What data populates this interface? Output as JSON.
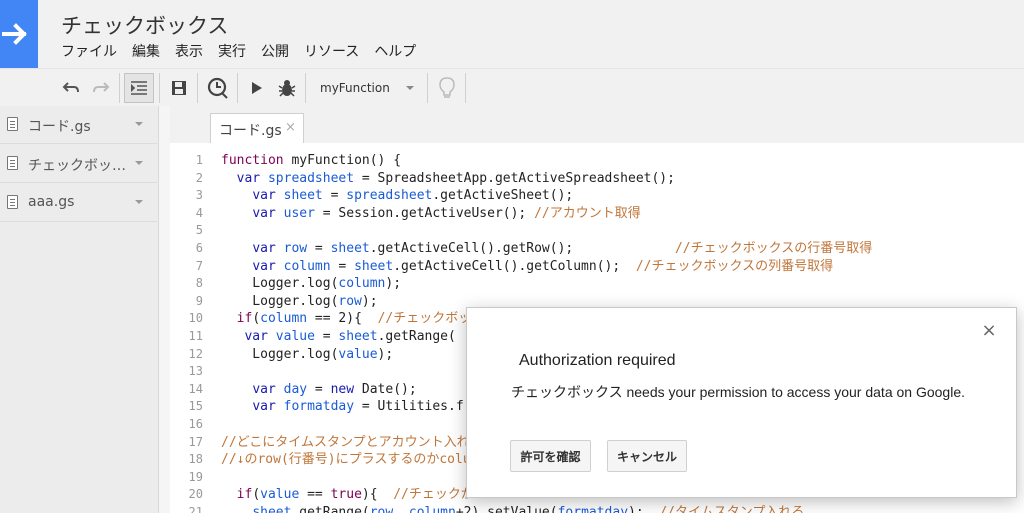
{
  "header": {
    "title": "チェックボックス",
    "menu": [
      "ファイル",
      "編集",
      "表示",
      "実行",
      "公開",
      "リソース",
      "ヘルプ"
    ]
  },
  "toolbar": {
    "icons": [
      "undo-icon",
      "redo-icon",
      "indent-icon",
      "save-icon",
      "trigger-clock-icon",
      "run-icon",
      "debug-bug-icon",
      "lightbulb-icon"
    ],
    "function_select": "myFunction"
  },
  "sidebar": {
    "files": [
      {
        "name": "コード.gs"
      },
      {
        "name": "チェックボッ…"
      },
      {
        "name": "aaa.gs"
      }
    ]
  },
  "editor": {
    "active_tab": "コード.gs",
    "tab_close": "×",
    "line_numbers": [
      "1",
      "2",
      "3",
      "4",
      "5",
      "6",
      "7",
      "8",
      "9",
      "10",
      "11",
      "12",
      "13",
      "14",
      "15",
      "16",
      "17",
      "18",
      "19",
      "20",
      "21"
    ],
    "lines": [
      "function myFunction() {",
      "  var spreadsheet = SpreadsheetApp.getActiveSpreadsheet();",
      "    var sheet = spreadsheet.getActiveSheet();",
      "    var user = Session.getActiveUser(); //アカウント取得",
      "",
      "    var row = sheet.getActiveCell().getRow();             //チェックボックスの行番号取得",
      "    var column = sheet.getActiveCell().getColumn();  //チェックボックスの列番号取得",
      "    Logger.log(column);",
      "    Logger.log(row);",
      "  if(column == 2){  //チェックボッ",
      "   var value = sheet.getRange(",
      "    Logger.log(value);",
      "",
      "    var day = new Date();",
      "    var formatday = Utilities.f",
      "",
      "//どこにタイムスタンプとアカウント入れるか",
      "//↓のrow(行番号)にプラスするのかcolu",
      "",
      "  if(value == true){  //チェックが",
      "    sheet.getRange(row, column+2).setValue(formatday);  //タイムスタンプ入れる"
    ]
  },
  "dialog": {
    "close": "×",
    "title": "Authorization required",
    "message": "チェックボックス needs your permission to access your data on Google.",
    "confirm_label": "許可を確認",
    "cancel_label": "キャンセル"
  },
  "colors": {
    "brand": "#4285f4",
    "keyword": "#7f0055",
    "variable": "#1a5bd6",
    "comment": "#c0763a"
  }
}
